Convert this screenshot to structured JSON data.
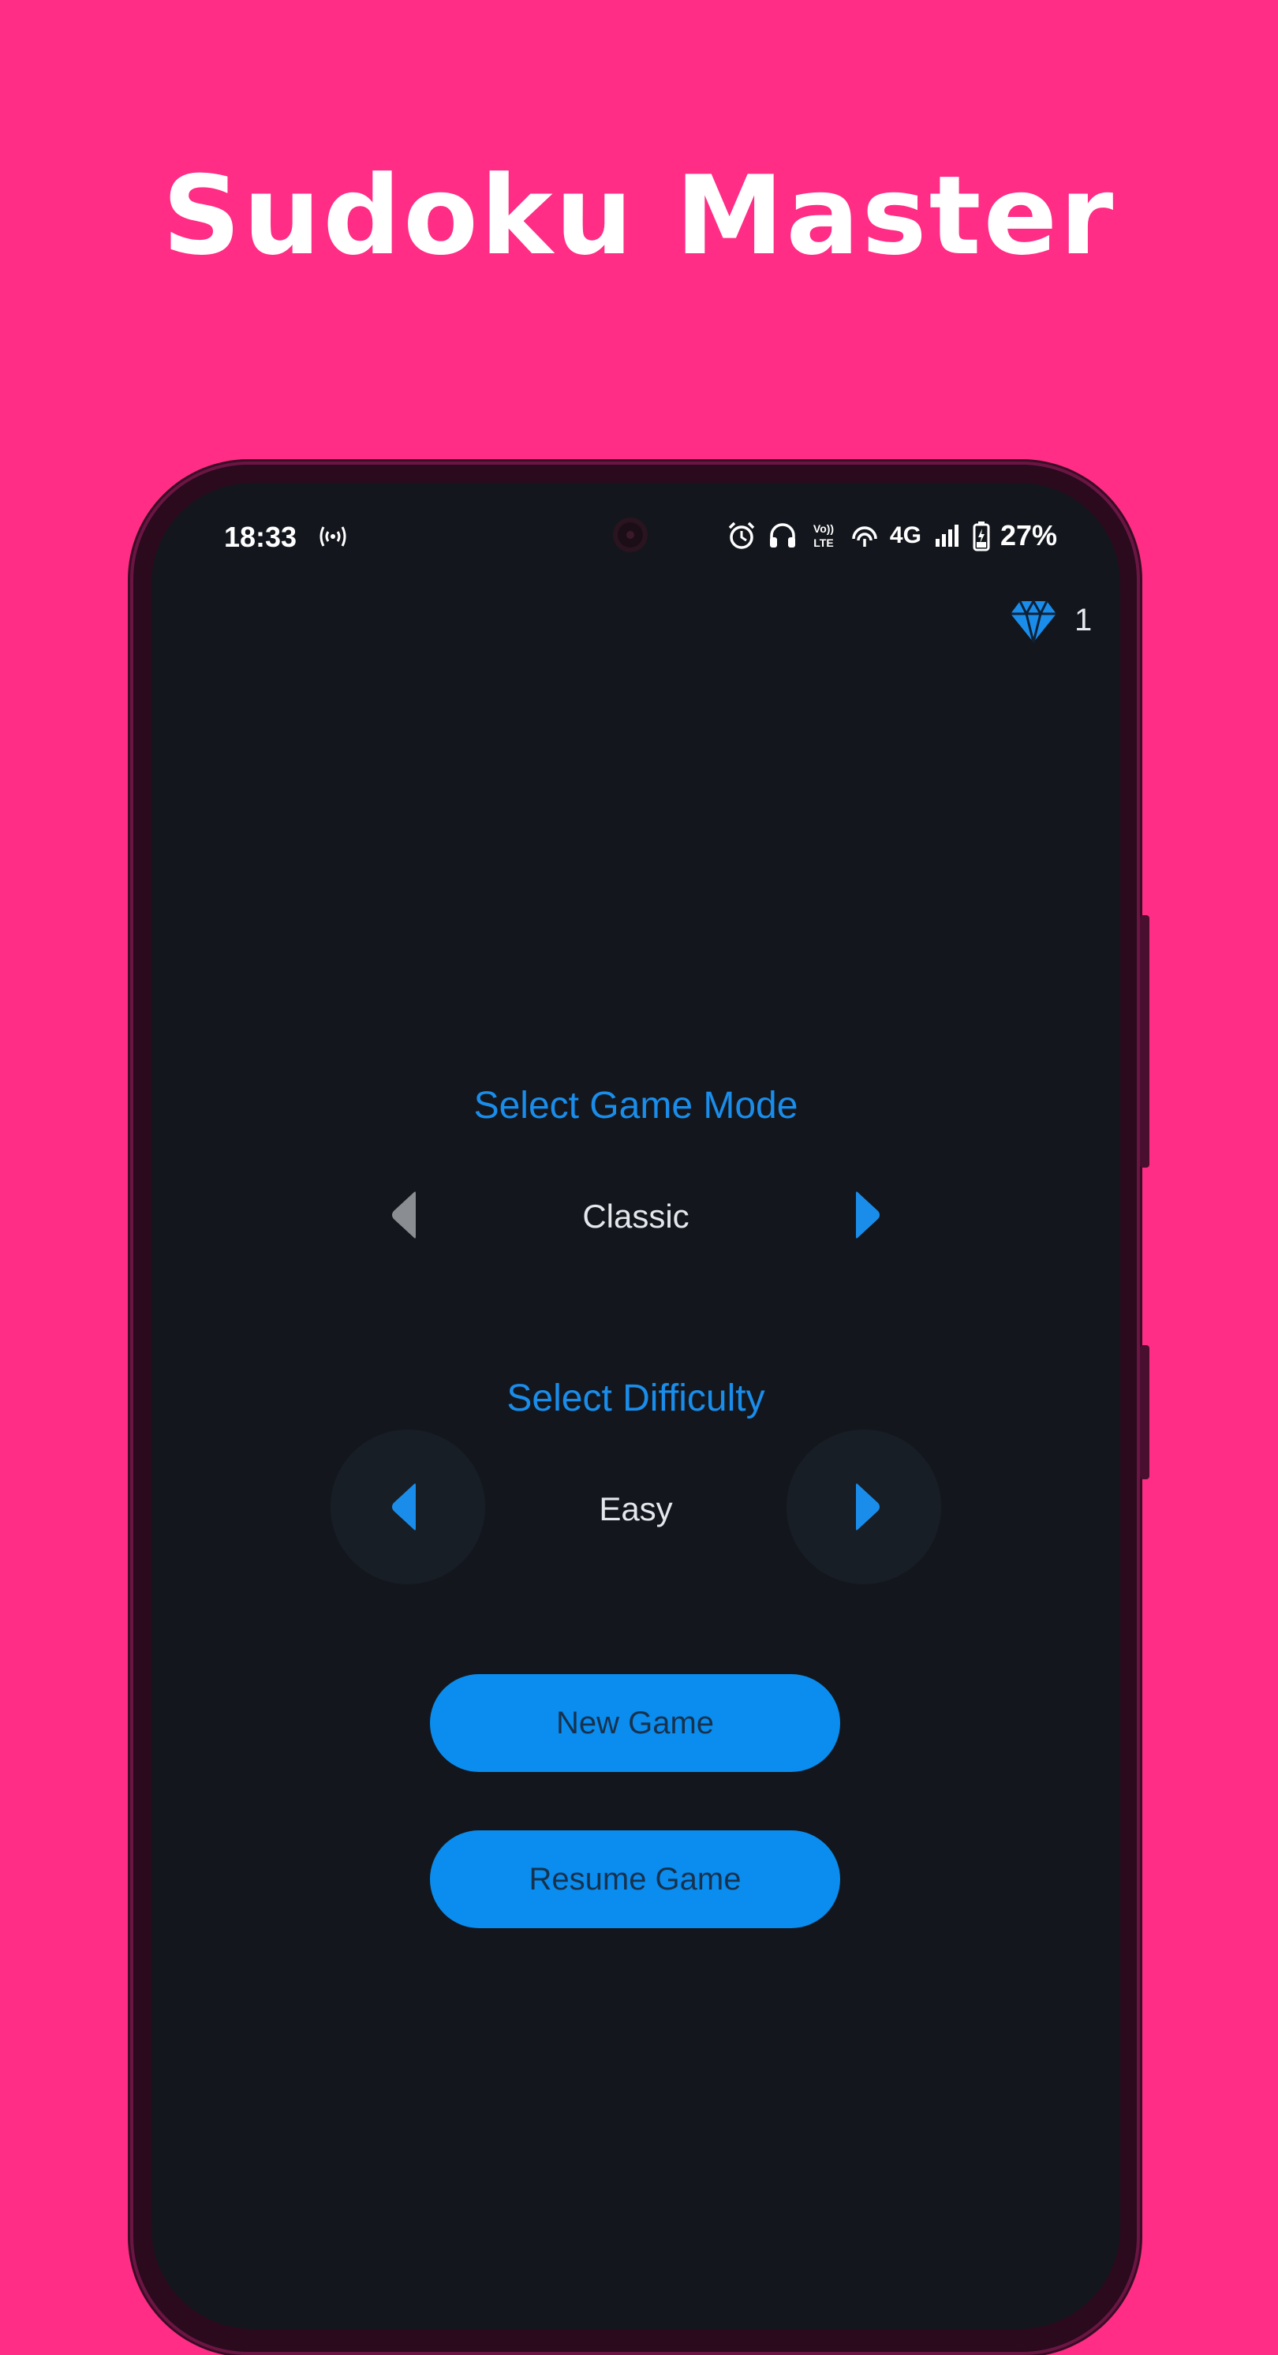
{
  "promo": {
    "headline": "Sudoku Master"
  },
  "status_bar": {
    "time": "18:33",
    "network": "4G",
    "battery": "27%",
    "icons": [
      "hotspot-icon",
      "alarm-icon",
      "headphones-icon",
      "volte-icon",
      "wireless-icon",
      "signal-icon",
      "battery-icon"
    ]
  },
  "header": {
    "gems": "1",
    "gem_icon": "diamond-icon"
  },
  "game_mode": {
    "title": "Select Game Mode",
    "value": "Classic",
    "prev_enabled": false,
    "next_enabled": true
  },
  "difficulty": {
    "title": "Select Difficulty",
    "value": "Easy",
    "prev_enabled": true,
    "next_enabled": true
  },
  "actions": {
    "new_game": "New Game",
    "resume_game": "Resume Game"
  },
  "colors": {
    "background": "#FF2D85",
    "screen": "#13171D",
    "accent": "#1A8DEB",
    "button": "#0A8DEE",
    "disabled": "#8A8D92"
  }
}
